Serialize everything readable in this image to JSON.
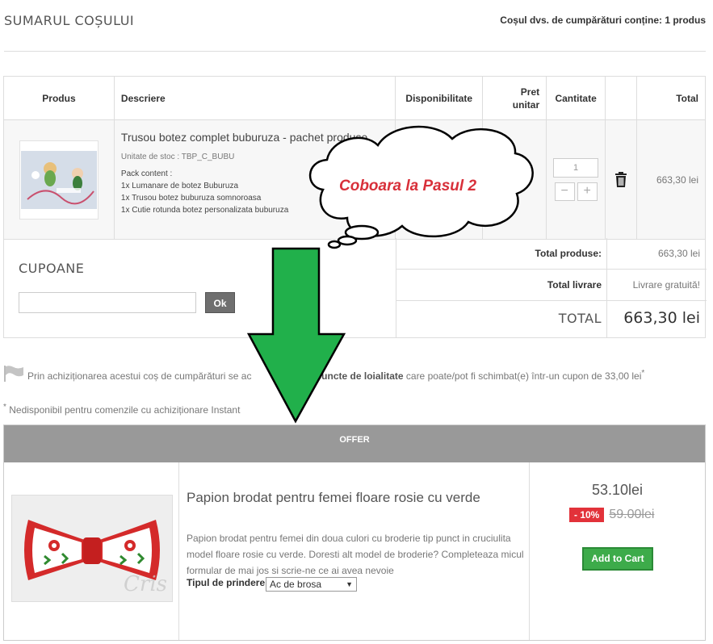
{
  "header": {
    "title": "SUMARUL COȘULUI",
    "summary": "Coșul dvs. de cumpărături conține: 1 produs"
  },
  "table": {
    "headers": {
      "product": "Produs",
      "description": "Descriere",
      "availability": "Disponibilitate",
      "unit_price_line1": "Pret",
      "unit_price_line2": "unitar",
      "quantity": "Cantitate",
      "total": "Total"
    },
    "item": {
      "name": "Trusou botez complet buburuza - pachet produse",
      "sku": "Unitate de stoc : TBP_C_BUBU",
      "pack_title": "Pack content :",
      "pack_items": [
        "1x Lumanare de botez Buburuza",
        "1x Trusou botez buburuza somnoroasa",
        "1x Cutie rotunda botez personalizata buburuza"
      ],
      "quantity": "1",
      "minus": "−",
      "plus": "+",
      "total": "663,30 lei"
    }
  },
  "coupons": {
    "title": "CUPOANE",
    "input_value": "",
    "ok_label": "Ok"
  },
  "totals": {
    "products_label": "Total produse:",
    "products_value": "663,30 lei",
    "shipping_label": "Total livrare",
    "shipping_value": "Livrare gratuită!",
    "grand_label": "TOTAL",
    "grand_value": "663,30 lei"
  },
  "loyalty": {
    "text_start": "Prin achiziționarea acestui coș de cumpărături se ac",
    "text_mid": "la",
    "points": "33 puncte de loialitate",
    "text_end": "care poate/pot fi schimbat(e) într-un cupon de 33,00 lei",
    "asterisk": "*",
    "instant_note": "Nedisponibil pentru comenzile cu achiziționare Instant"
  },
  "callout": {
    "text": "Coboara la Pasul 2"
  },
  "offer": {
    "header": "OFFER",
    "name": "Papion brodat pentru femei floare rosie cu verde",
    "description": "Papion brodat pentru femei din doua culori cu broderie tip punct in cruciulita model floare rosie cu verde. Doresti alt model de broderie? Completeaza micul formular de mai jos si scrie-ne ce ai avea nevoie",
    "attach_label": "Tipul de prindere",
    "attach_value": "Ac de brosa",
    "price": "53.10lei",
    "discount": "- 10%",
    "old_price": "59.00lei",
    "add_to_cart": "Add to Cart",
    "watermark": "Cris"
  },
  "colors": {
    "accent_green": "#3dab4a",
    "arrow_green": "#21b04b",
    "discount_red": "#e2323a",
    "callout_red": "#d8303a",
    "offer_header": "#999999"
  }
}
